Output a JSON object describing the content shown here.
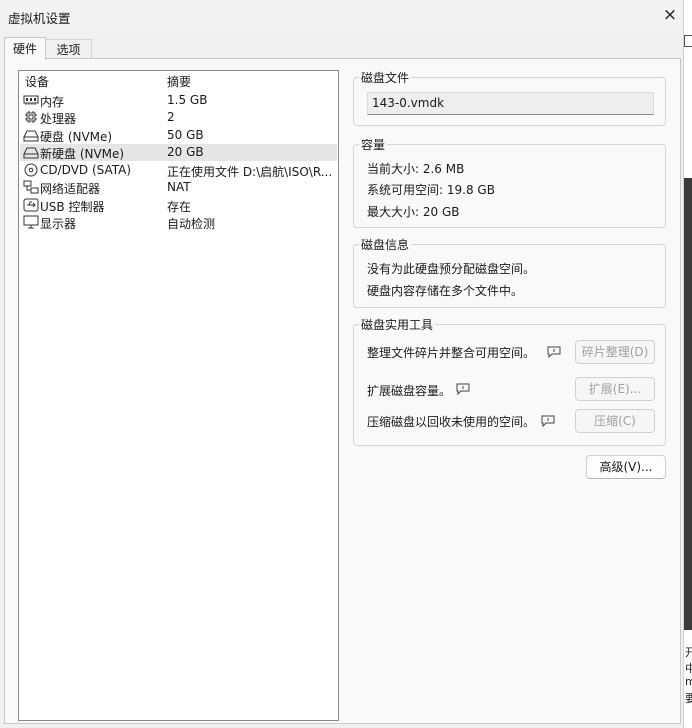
{
  "window": {
    "title": "虚拟机设置",
    "close_label": "×"
  },
  "tabs": [
    {
      "label": "硬件"
    },
    {
      "label": "选项"
    }
  ],
  "devices": {
    "header_device": "设备",
    "header_summary": "摘要",
    "rows": [
      {
        "name": "内存",
        "summary": "1.5 GB",
        "icon": "memory-icon"
      },
      {
        "name": "处理器",
        "summary": "2",
        "icon": "processor-icon"
      },
      {
        "name": "硬盘 (NVMe)",
        "summary": "50 GB",
        "icon": "disk-icon"
      },
      {
        "name": "新硬盘 (NVMe)",
        "summary": "20 GB",
        "icon": "disk-icon",
        "selected": true
      },
      {
        "name": "CD/DVD (SATA)",
        "summary": "正在使用文件 D:\\启航\\ISO\\R...",
        "icon": "cd-icon"
      },
      {
        "name": "网络适配器",
        "summary": "NAT",
        "icon": "network-icon"
      },
      {
        "name": "USB 控制器",
        "summary": "存在",
        "icon": "usb-icon"
      },
      {
        "name": "显示器",
        "summary": "自动检测",
        "icon": "display-icon"
      }
    ]
  },
  "disk_file": {
    "label": "磁盘文件",
    "value": "143-0.vmdk"
  },
  "capacity": {
    "label": "容量",
    "current": "当前大小: 2.6 MB",
    "available": "系统可用空间: 19.8 GB",
    "max": "最大大小: 20 GB"
  },
  "disk_info": {
    "label": "磁盘信息",
    "line1": "没有为此硬盘预分配磁盘空间。",
    "line2": "硬盘内容存储在多个文件中。"
  },
  "utilities": {
    "label": "磁盘实用工具",
    "defrag_text": "整理文件碎片并整合可用空间。",
    "defrag_button": "碎片整理(D)",
    "expand_text": "扩展磁盘容量。",
    "expand_button": "扩展(E)...",
    "compact_text": "压缩磁盘以回收未使用的空间。",
    "compact_button": "压缩(C)"
  },
  "advanced_button": "高级(V)...",
  "background_fragments": [
    "开",
    "中",
    "m",
    "要"
  ]
}
